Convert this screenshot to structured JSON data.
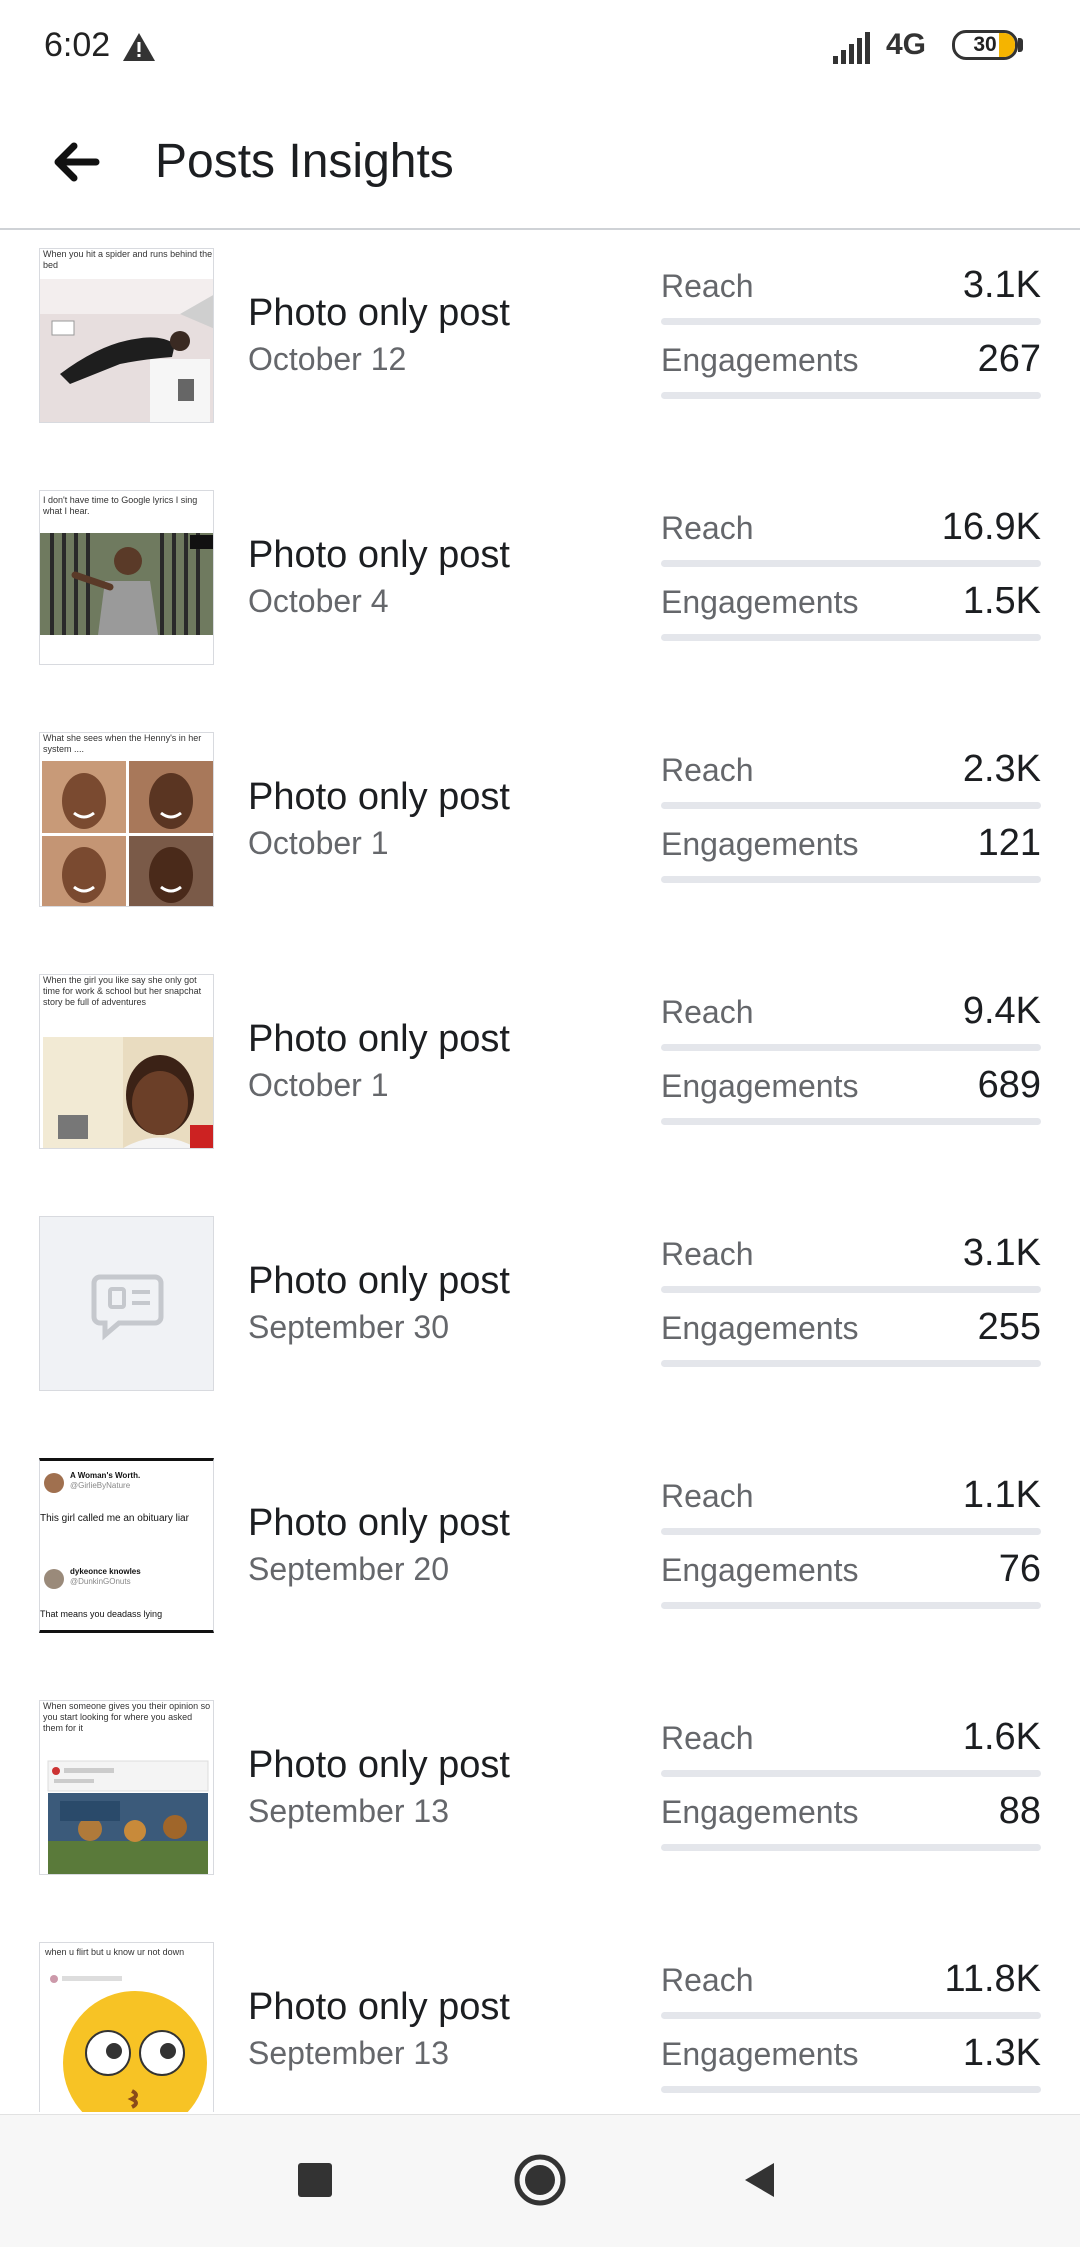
{
  "status_bar": {
    "time": "6:02",
    "network": "4G",
    "battery": "30"
  },
  "header": {
    "title": "Posts Insights"
  },
  "metric_labels": {
    "reach": "Reach",
    "engagements": "Engagements"
  },
  "posts": [
    {
      "type": "Photo only post",
      "date": "October 12",
      "reach": "3.1K",
      "engagements": "267",
      "thumb_caption": "When you hit a spider and runs behind the bed"
    },
    {
      "type": "Photo only post",
      "date": "October 4",
      "reach": "16.9K",
      "engagements": "1.5K",
      "thumb_caption": "I don't have time to Google lyrics I sing what I hear."
    },
    {
      "type": "Photo only post",
      "date": "October 1",
      "reach": "2.3K",
      "engagements": "121",
      "thumb_caption": "What she sees when the Henny's in her system ...."
    },
    {
      "type": "Photo only post",
      "date": "October 1",
      "reach": "9.4K",
      "engagements": "689",
      "thumb_caption": "When the girl you like say she only got time for work & school but her snapchat story be full of adventures"
    },
    {
      "type": "Photo only post",
      "date": "September 30",
      "reach": "3.1K",
      "engagements": "255",
      "thumb_caption": ""
    },
    {
      "type": "Photo only post",
      "date": "September 20",
      "reach": "1.1K",
      "engagements": "76",
      "thumb_caption": "This girl called me an obituary liar"
    },
    {
      "type": "Photo only post",
      "date": "September 13",
      "reach": "1.6K",
      "engagements": "88",
      "thumb_caption": "When someone gives you their opinion so you start looking for where you asked them for it"
    },
    {
      "type": "Photo only post",
      "date": "September 13",
      "reach": "11.8K",
      "engagements": "1.3K",
      "thumb_caption": "when u flirt but u know ur not down"
    }
  ],
  "thumb_texts": {
    "p6_name1": "A Woman's Worth.",
    "p6_handle1": "@GirlieByNature",
    "p6_name2": "dykeonce knowles",
    "p6_handle2": "@DunkinGOnuts",
    "p6_reply": "That means you deadass lying"
  }
}
